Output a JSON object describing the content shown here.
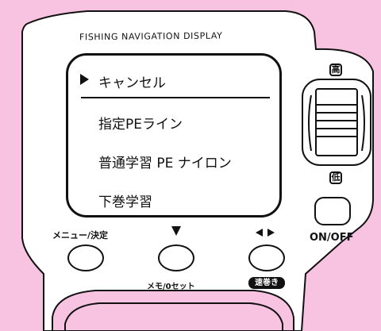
{
  "device": {
    "title": "FISHING NAVIGATION DISPLAY",
    "body_color": "#ffffff",
    "background_color": "#f7c3e1",
    "outline_color": "#111111"
  },
  "screen": {
    "menu_items": [
      {
        "label": "キャンセル",
        "selected": true
      },
      {
        "label": "指定PEライン",
        "selected": false
      },
      {
        "label": "普通学習 PE ナイロン",
        "selected": false
      },
      {
        "label": "下巻学習",
        "selected": false
      }
    ]
  },
  "dial": {
    "high_label": "高",
    "low_label": "低"
  },
  "buttons": {
    "menu_label": "メニュー/決定",
    "memo_label": "メモ/0セット",
    "fast_wind_label": "速巻き",
    "power_label": "ON/OFF",
    "down_icon": "triangle-down-icon",
    "left_right_icon": "left-right-arrows-icon"
  }
}
